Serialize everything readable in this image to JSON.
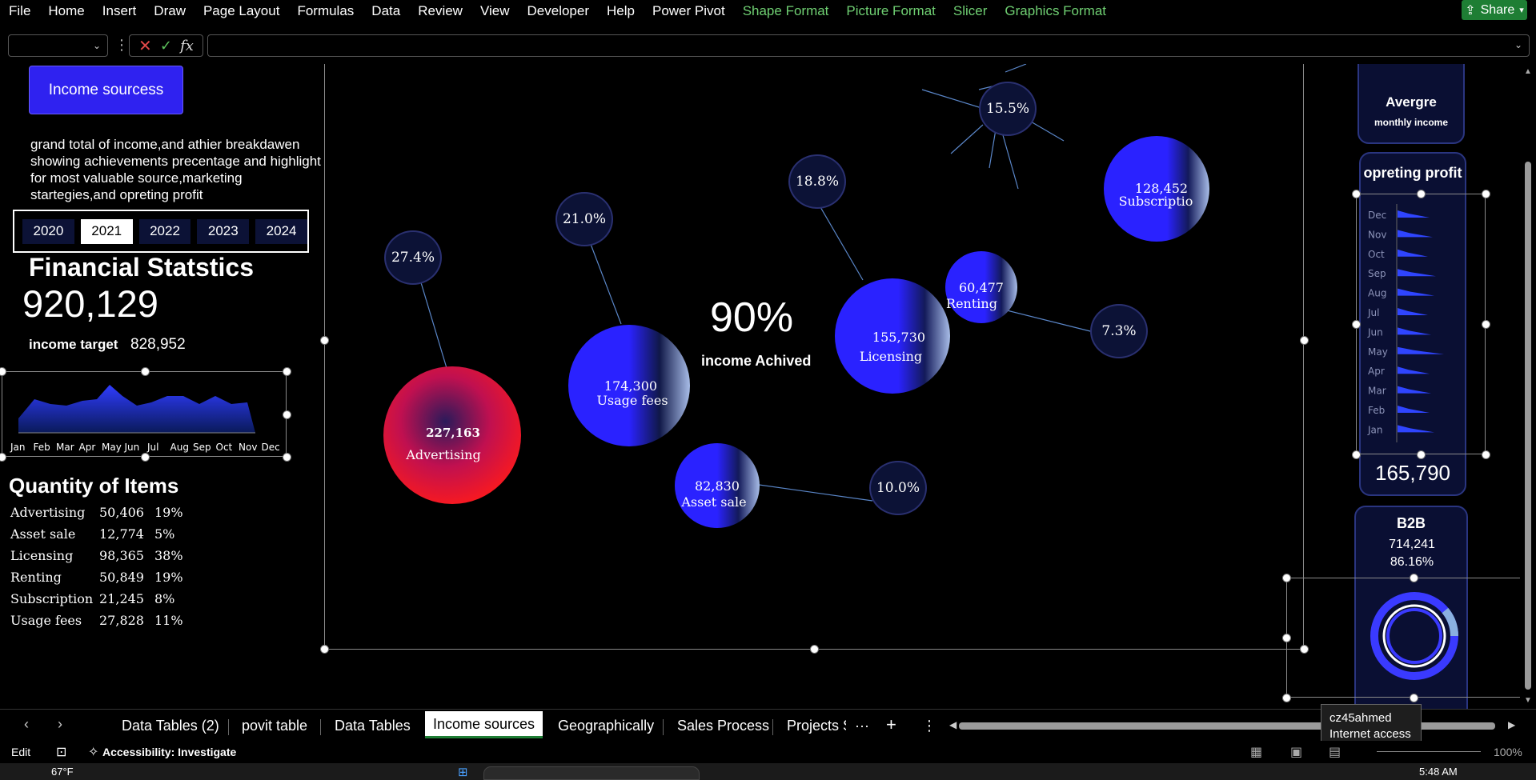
{
  "menu": {
    "items": [
      "File",
      "Home",
      "Insert",
      "Draw",
      "Page Layout",
      "Formulas",
      "Data",
      "Review",
      "View",
      "Developer",
      "Help",
      "Power Pivot"
    ],
    "context_items": [
      "Shape Format",
      "Picture Format",
      "Slicer",
      "Graphics Format"
    ],
    "share_label": "Share"
  },
  "formula": {
    "fx_label": "fx"
  },
  "dashboard": {
    "title_button": "Income sourcess",
    "description": "grand total of income,and athier breakdawen showing achievements precentage and highlight for most valuable source,marketing startegies,and opreting profit",
    "years": [
      "2020",
      "2021",
      "2022",
      "2023",
      "2024"
    ],
    "selected_year": "2021",
    "financial_title": "Financial Statstics",
    "grand_total": "920,129",
    "income_target_label": "income target",
    "income_target_value": "828,952",
    "months": [
      "Jan",
      "Feb",
      "Mar",
      "Apr",
      "May",
      "Jun",
      "Jul",
      "Aug",
      "Sep",
      "Oct",
      "Nov",
      "Dec"
    ],
    "quantity_title": "Quantity of Items",
    "quantity_rows": [
      {
        "name": "Advertising",
        "qty": "50,406",
        "pct": "19%"
      },
      {
        "name": "Asset sale",
        "qty": "12,774",
        "pct": "5%"
      },
      {
        "name": "Licensing",
        "qty": "98,365",
        "pct": "38%"
      },
      {
        "name": "Renting",
        "qty": "50,849",
        "pct": "19%"
      },
      {
        "name": "Subscription",
        "qty": "21,245",
        "pct": "8%"
      },
      {
        "name": "Usage fees",
        "qty": "27,828",
        "pct": "11%"
      }
    ],
    "achieved_pct": "90%",
    "achieved_label": "income Achived"
  },
  "chart_data": {
    "type": "scatter",
    "bubbles": [
      {
        "name": "Advertising",
        "value": "227,163",
        "pct": "27.4%"
      },
      {
        "name": "Usage fees",
        "value": "174,300",
        "pct": "21.0%"
      },
      {
        "name": "Licensing",
        "value": "155,730",
        "pct": "18.8%"
      },
      {
        "name": "Subscriptio",
        "value": "128,452",
        "pct": "15.5%"
      },
      {
        "name": "Asset sale",
        "value": "82,830",
        "pct": "10.0%"
      },
      {
        "name": "Renting",
        "value": "60,477",
        "pct": "7.3%"
      }
    ]
  },
  "right_panels": {
    "avg_title": "Avergre",
    "avg_sub": "monthly income",
    "profit_title": "opreting profit",
    "profit_months": [
      "Dec",
      "Nov",
      "Oct",
      "Sep",
      "Aug",
      "Jul",
      "Jun",
      "May",
      "Apr",
      "Mar",
      "Feb",
      "Jan"
    ],
    "profit_total": "165,790",
    "b2b_title": "B2B",
    "b2b_value": "714,241",
    "b2b_pct": "86.16%"
  },
  "tabs": [
    "Data Tables (2)",
    "povit table",
    "Data Tables",
    "Income sources",
    "Geographically",
    "Sales Process",
    "Projects S"
  ],
  "active_tab": "Income sources",
  "tooltip": {
    "user": "cz45ahmed",
    "status": "Internet access"
  },
  "status": {
    "mode": "Edit",
    "accessibility": "Accessibility: Investigate",
    "zoom": "100%",
    "temp": "67°F",
    "time": "5:48 AM"
  },
  "colors": {
    "accent": "#2f22f0",
    "panel": "#0a0f33",
    "green": "#6fcf72"
  }
}
